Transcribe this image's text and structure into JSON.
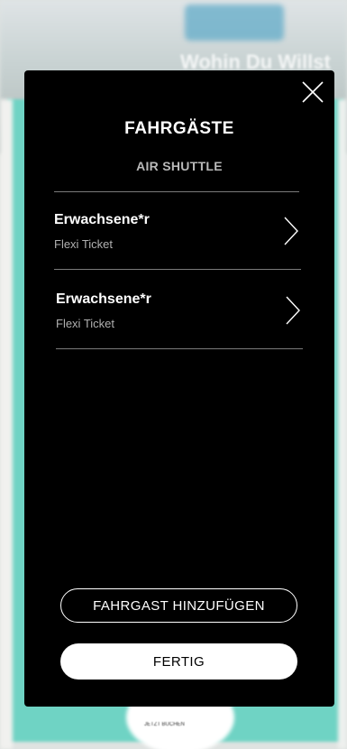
{
  "background": {
    "headline": "Wohin Du Willst",
    "cta_label": "JETZT BUCHEN"
  },
  "modal": {
    "title": "FAHRGÄSTE",
    "subtitle": "AIR SHUTTLE",
    "close_icon": "close-icon",
    "passengers": [
      {
        "name": "Erwachsene*r",
        "ticket": "Flexi Ticket",
        "icon": "chevron-right-icon"
      },
      {
        "name": "Erwachsene*r",
        "ticket": "Flexi Ticket",
        "icon": "chevron-right-icon"
      }
    ],
    "add_passenger_label": "FAHRGAST HINZUFÜGEN",
    "done_label": "FERTIG"
  },
  "colors": {
    "modal_bg": "#000000",
    "accent_teal": "#6fd3c4",
    "text_primary": "#ffffff",
    "text_secondary": "#b0b0b0"
  }
}
